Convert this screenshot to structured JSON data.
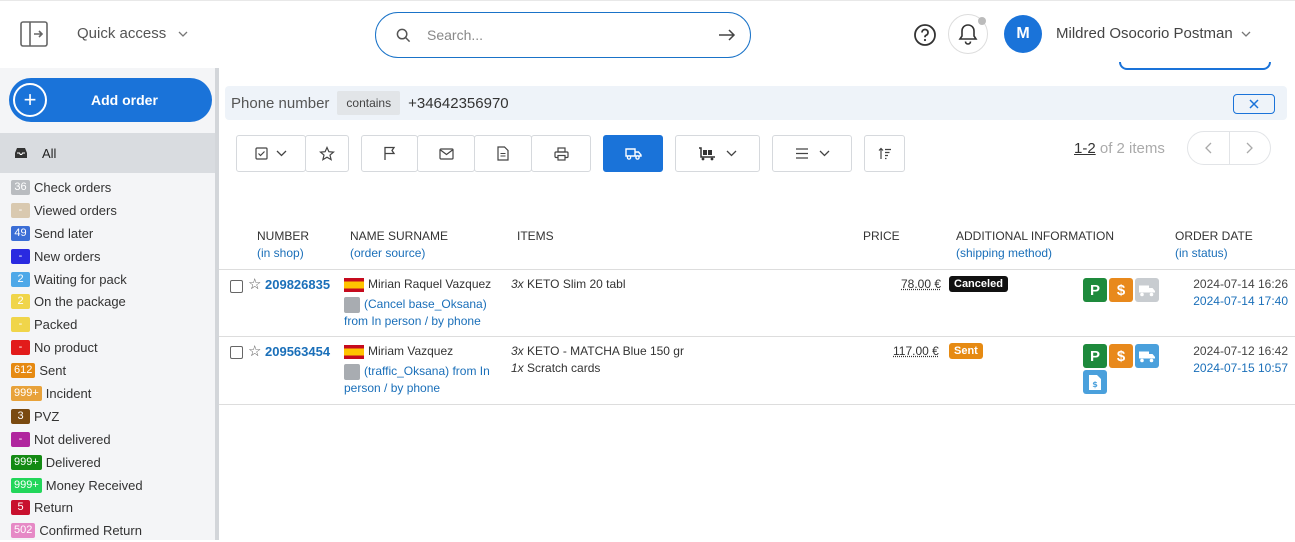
{
  "header": {
    "quick_access": "Quick access",
    "search_placeholder": "Search...",
    "avatar_initial": "M",
    "user_name": "Mildred Osocorio Postman"
  },
  "sidebar": {
    "add_order": "Add order",
    "all_label": "All",
    "items": [
      {
        "badge": "36",
        "label": "Check orders",
        "color": "#b9bcc0"
      },
      {
        "badge": "-",
        "label": "Viewed orders",
        "color": "#d9c9b0"
      },
      {
        "badge": "49",
        "label": "Send later",
        "color": "#3b6ed6"
      },
      {
        "badge": "-",
        "label": "New orders",
        "color": "#2a2ae0"
      },
      {
        "badge": "2",
        "label": "Waiting for pack",
        "color": "#4ea8e8"
      },
      {
        "badge": "2",
        "label": "On the package",
        "color": "#f0d54a"
      },
      {
        "badge": "-",
        "label": "Packed",
        "color": "#f0d54a"
      },
      {
        "badge": "-",
        "label": "No product",
        "color": "#e21b1b"
      },
      {
        "badge": "612",
        "label": "Sent",
        "color": "#e68a12"
      },
      {
        "badge": "999+",
        "label": "Incident",
        "color": "#e8a23a"
      },
      {
        "badge": "3",
        "label": "PVZ",
        "color": "#7a4a10"
      },
      {
        "badge": "-",
        "label": "Not delivered",
        "color": "#b0259e"
      },
      {
        "badge": "999+",
        "label": "Delivered",
        "color": "#148a14"
      },
      {
        "badge": "999+",
        "label": "Money Received",
        "color": "#22d65a"
      },
      {
        "badge": "5",
        "label": "Return",
        "color": "#c8102e"
      },
      {
        "badge": "502",
        "label": "Confirmed Return",
        "color": "#e689c6"
      }
    ]
  },
  "filter": {
    "field": "Phone number",
    "operator": "contains",
    "value": "+34642356970"
  },
  "pager": {
    "range": "1-2",
    "total": " of 2 items"
  },
  "table": {
    "headers": {
      "number": "NUMBER",
      "number_sub": "(in shop)",
      "name": "NAME SURNAME",
      "name_sub": "(order source)",
      "items": "ITEMS",
      "price": "PRICE",
      "info": "ADDITIONAL INFORMATION",
      "info_sub": "(shipping method)",
      "date": "ORDER DATE",
      "date_sub": "(in status)"
    },
    "rows": [
      {
        "number": "209826835",
        "name": "Mirian Raquel Vazquez",
        "source_link": "(Cancel base_Oksana)",
        "source_rest": "from In person / by phone",
        "items": [
          {
            "qty": "3x",
            "name": "KETO Slim 20 tabl"
          }
        ],
        "price": "78.00 €",
        "status": "Canceled",
        "status_color": "#111111",
        "order_date": "2024-07-14 16:26",
        "status_date": "2024-07-14 17:40"
      },
      {
        "number": "209563454",
        "name": "Miriam Vazquez",
        "source_link": "(traffic_Oksana) from In",
        "source_rest": "person / by phone",
        "items": [
          {
            "qty": "3x",
            "name": "KETO - MATCHA Blue 150 gr"
          },
          {
            "qty": "1x",
            "name": "Scratch cards"
          }
        ],
        "price": "117.00 €",
        "status": "Sent",
        "status_color": "#e68a12",
        "order_date": "2024-07-12 16:42",
        "status_date": "2024-07-15 10:57"
      }
    ]
  },
  "icons": {
    "p_letter": "P",
    "dollar": "$",
    "p_color": "#1e8a3c",
    "dollar_color": "#e8891c",
    "truck_inactive_color": "#c8ccd0",
    "truck_active_color": "#4aa0dc",
    "doc_color": "#4aa0dc"
  }
}
